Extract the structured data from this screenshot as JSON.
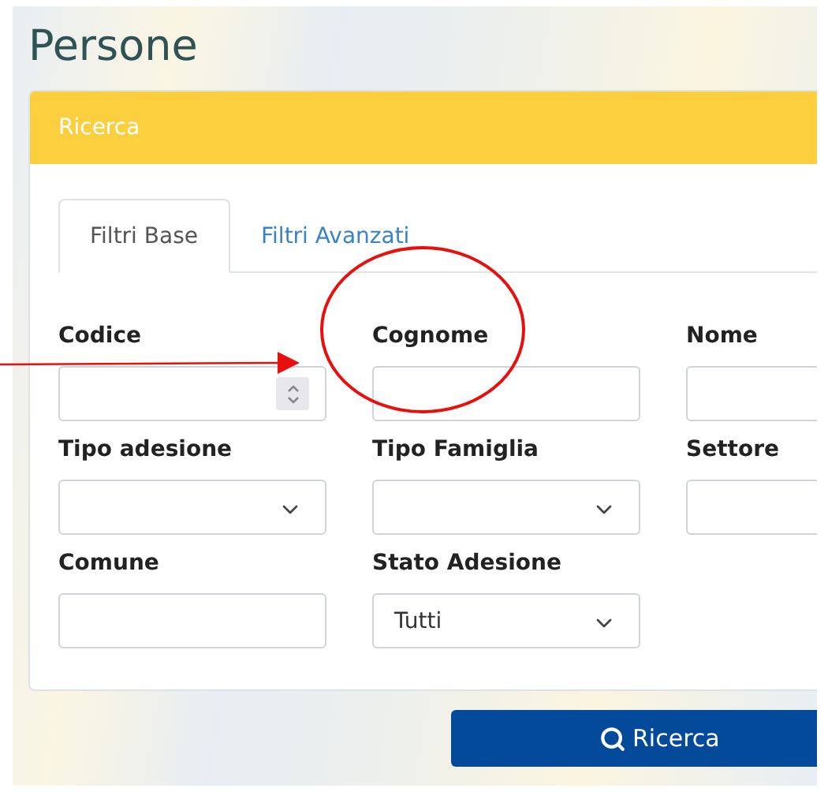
{
  "page": {
    "title": "Persone"
  },
  "panel": {
    "title": "Ricerca"
  },
  "tabs": [
    {
      "label": "Filtri Base",
      "selected": true
    },
    {
      "label": "Filtri Avanzati",
      "selected": false
    }
  ],
  "fields": [
    {
      "label": "Codice",
      "kind": "number"
    },
    {
      "label": "Cognome",
      "kind": "text"
    },
    {
      "label": "Nome",
      "kind": "text"
    },
    {
      "label": "Tipo adesione",
      "kind": "select"
    },
    {
      "label": "Tipo Famiglia",
      "kind": "select"
    },
    {
      "label": "Settore",
      "kind": "text"
    },
    {
      "label": "Comune",
      "kind": "text"
    },
    {
      "label": "Stato Adesione",
      "kind": "select",
      "value": "Tutti"
    }
  ],
  "search_button": {
    "label": "Ricerca"
  }
}
